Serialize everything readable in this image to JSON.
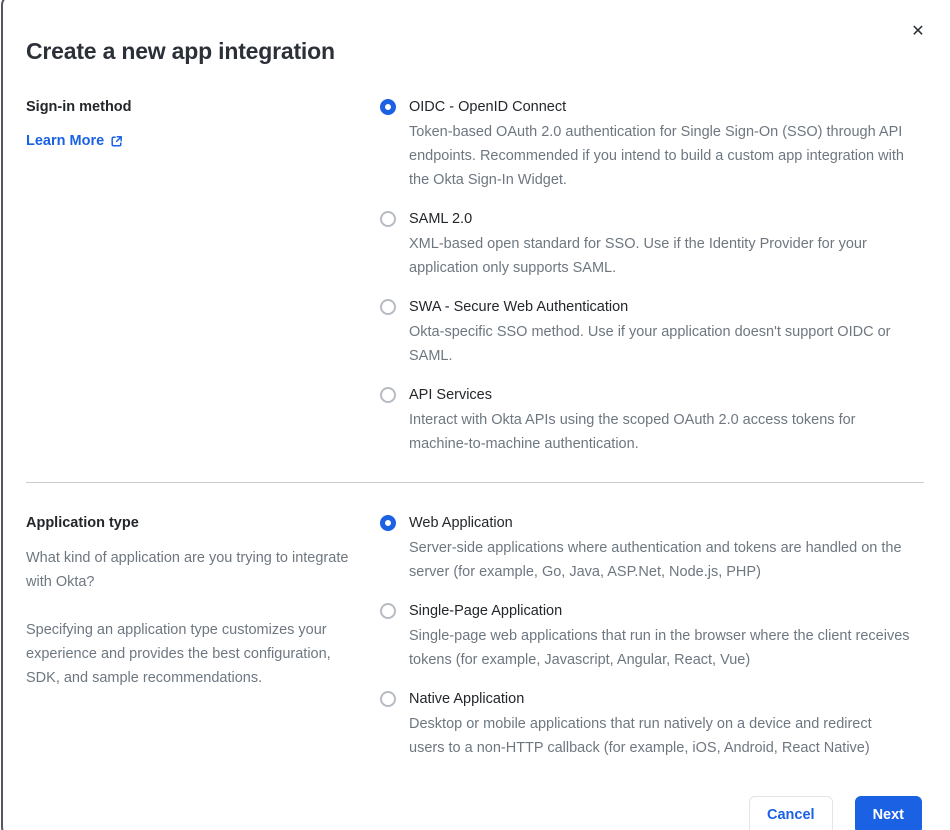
{
  "dialog": {
    "title": "Create a new app integration",
    "close_icon": "✕"
  },
  "signin_section": {
    "label": "Sign-in method",
    "learn_more_label": "Learn More",
    "options": [
      {
        "label": "OIDC - OpenID Connect",
        "description": "Token-based OAuth 2.0 authentication for Single Sign-On (SSO) through API endpoints. Recommended if you intend to build a custom app integration with the Okta Sign-In Widget.",
        "selected": true
      },
      {
        "label": "SAML 2.0",
        "description": "XML-based open standard for SSO. Use if the Identity Provider for your application only supports SAML.",
        "selected": false
      },
      {
        "label": "SWA - Secure Web Authentication",
        "description": "Okta-specific SSO method. Use if your application doesn't support OIDC or SAML.",
        "selected": false
      },
      {
        "label": "API Services",
        "description": "Interact with Okta APIs using the scoped OAuth 2.0 access tokens for machine-to-machine authentication.",
        "selected": false
      }
    ]
  },
  "apptype_section": {
    "label": "Application type",
    "description_1": "What kind of application are you trying to integrate with Okta?",
    "description_2": "Specifying an application type customizes your experience and provides the best configuration, SDK, and sample recommendations.",
    "options": [
      {
        "label": "Web Application",
        "description": "Server-side applications where authentication and tokens are handled on the server (for example, Go, Java, ASP.Net, Node.js, PHP)",
        "selected": true
      },
      {
        "label": "Single-Page Application",
        "description": "Single-page web applications that run in the browser where the client receives tokens (for example, Javascript, Angular, React, Vue)",
        "selected": false
      },
      {
        "label": "Native Application",
        "description": "Desktop or mobile applications that run natively on a device and redirect users to a non-HTTP callback (for example, iOS, Android, React Native)",
        "selected": false
      }
    ]
  },
  "footer": {
    "cancel_label": "Cancel",
    "next_label": "Next"
  },
  "colors": {
    "accent_blue": "#1b61e4",
    "heading_text": "#2c3038",
    "body_text": "#6e7780",
    "radio_unselected_border": "#b7bbc3",
    "divider": "#cbcbcb",
    "dialog_border": "#54565f"
  }
}
